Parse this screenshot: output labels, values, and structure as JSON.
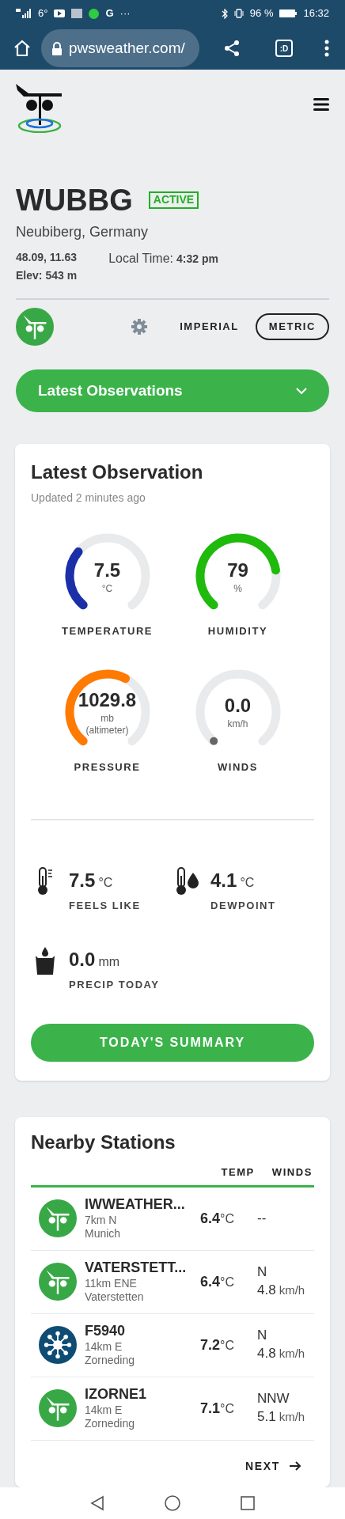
{
  "status_bar": {
    "notifications": [
      "6°",
      "G",
      "···"
    ],
    "battery": "96 %",
    "time": "16:32"
  },
  "browser": {
    "url": "pwsweather.com/",
    "tab_count": ":D"
  },
  "station": {
    "id": "WUBBG",
    "status": "ACTIVE",
    "location": "Neubiberg, Germany",
    "coords": "48.09, 11.63",
    "elevation_label": "Elev:",
    "elevation": "543 m",
    "local_time_label": "Local Time:",
    "local_time": "4:32 pm"
  },
  "units": [
    {
      "label": "IMPERIAL",
      "selected": false
    },
    {
      "label": "METRIC",
      "selected": true
    }
  ],
  "section_dropdown": {
    "label": "Latest Observations",
    "expanded": false
  },
  "observation": {
    "title": "Latest Observation",
    "updated": "Updated 2 minutes ago",
    "gauges": [
      {
        "value": "7.5",
        "unit": "°C",
        "label": "TEMPERATURE",
        "color": "#1a2fa8"
      },
      {
        "value": "79",
        "unit": "%",
        "label": "HUMIDITY",
        "color": "#1fba0c"
      },
      {
        "value": "1029.8",
        "unit": "mb",
        "note": "(altimeter)",
        "label": "PRESSURE",
        "color": "#ff7a00"
      },
      {
        "value": "0.0",
        "unit": "km/h",
        "label": "WINDS",
        "color": "#666666"
      }
    ],
    "stats": [
      {
        "kind": "thermometer",
        "value": "7.5",
        "unit": "°C",
        "label": "FEELS LIKE"
      },
      {
        "kind": "dewpoint",
        "value": "4.1",
        "unit": "°C",
        "label": "DEWPOINT"
      },
      {
        "kind": "precip",
        "value": "0.0",
        "unit": "mm",
        "label": "PRECIP TODAY"
      }
    ],
    "summary_button": "TODAY'S SUMMARY"
  },
  "nearby": {
    "title": "Nearby Stations",
    "columns": [
      "TEMP",
      "WINDS"
    ],
    "rows": [
      {
        "kind": "vane",
        "name": "IWWEATHER...",
        "distance": "7km N",
        "city": "Munich",
        "temp": "6.4",
        "temp_unit": "°C",
        "wind_dir": "--"
      },
      {
        "kind": "vane",
        "name": "VATERSTETT...",
        "distance": "11km ENE",
        "city": "Vaterstetten",
        "temp": "6.4",
        "temp_unit": "°C",
        "wind_dir": "N",
        "wind_speed": "4.8",
        "wind_unit": "km/h"
      },
      {
        "kind": "network",
        "name": "F5940",
        "distance": "14km E",
        "city": "Zorneding",
        "temp": "7.2",
        "temp_unit": "°C",
        "wind_dir": "N",
        "wind_speed": "4.8",
        "wind_unit": "km/h"
      },
      {
        "kind": "vane",
        "name": "IZORNE1",
        "distance": "14km E",
        "city": "Zorneding",
        "temp": "7.1",
        "temp_unit": "°C",
        "wind_dir": "NNW",
        "wind_speed": "5.1",
        "wind_unit": "km/h"
      }
    ],
    "next": "NEXT"
  }
}
